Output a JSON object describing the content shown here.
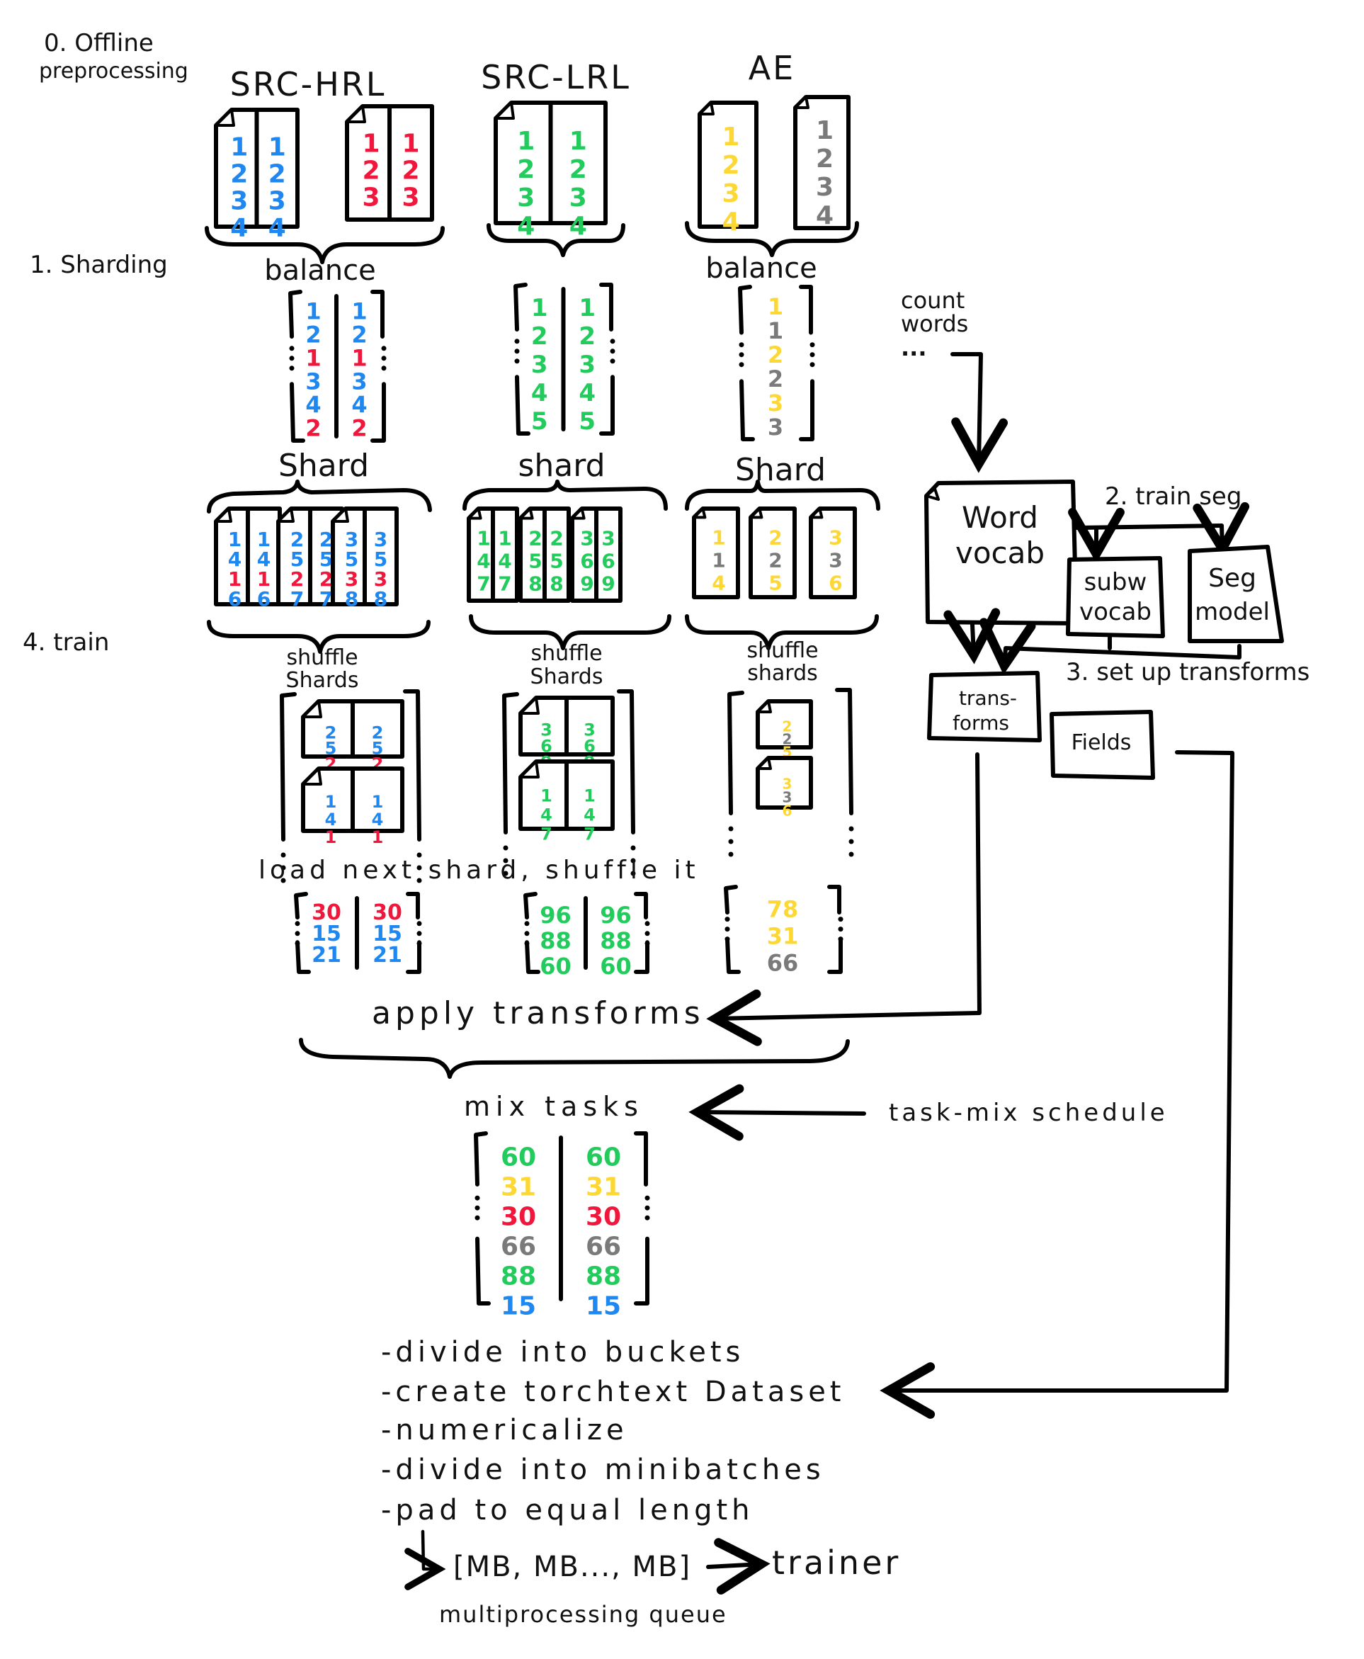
{
  "colors": {
    "hrl": "#1e88f0",
    "hrl_alt": "#f0163c",
    "lrl": "#22cc5c",
    "ae": "#fdd835",
    "ae_alt": "#7a7a7a",
    "ink": "#000000"
  },
  "steps": {
    "step0": "0. Offline preprocessing",
    "step0_line1": "0. Offline",
    "step0_line2": "preprocessing",
    "step1": "1. Sharding",
    "step2": "2. train seg",
    "step3": "3. set up transforms",
    "step4": "4. train"
  },
  "sources": [
    {
      "name": "SRC-HRL",
      "docs": [
        {
          "columns": [
            [
              [
                "1",
                "hrl"
              ],
              [
                "2",
                "hrl"
              ],
              [
                "3",
                "hrl"
              ],
              [
                "4",
                "hrl"
              ]
            ],
            [
              [
                "1",
                "hrl"
              ],
              [
                "2",
                "hrl"
              ],
              [
                "3",
                "hrl"
              ],
              [
                "4",
                "hrl"
              ]
            ]
          ]
        },
        {
          "columns": [
            [
              [
                "1",
                "hrl_alt"
              ],
              [
                "2",
                "hrl_alt"
              ],
              [
                "3",
                "hrl_alt"
              ]
            ],
            [
              [
                "1",
                "hrl_alt"
              ],
              [
                "2",
                "hrl_alt"
              ],
              [
                "3",
                "hrl_alt"
              ]
            ]
          ]
        }
      ],
      "balance_label": "balance",
      "balanced": [
        [
          [
            "1",
            "hrl"
          ],
          [
            "2",
            "hrl"
          ],
          [
            "1",
            "hrl_alt"
          ],
          [
            "3",
            "hrl"
          ],
          [
            "4",
            "hrl"
          ],
          [
            "2",
            "hrl_alt"
          ]
        ],
        [
          [
            "1",
            "hrl"
          ],
          [
            "2",
            "hrl"
          ],
          [
            "1",
            "hrl_alt"
          ],
          [
            "3",
            "hrl"
          ],
          [
            "4",
            "hrl"
          ],
          [
            "2",
            "hrl_alt"
          ]
        ]
      ],
      "shard_label": "Shard",
      "shards": [
        [
          [
            [
              "1",
              "hrl"
            ],
            [
              "4",
              "hrl"
            ],
            [
              "1",
              "hrl_alt"
            ],
            [
              "6",
              "hrl"
            ]
          ],
          [
            [
              "1",
              "hrl"
            ],
            [
              "4",
              "hrl"
            ],
            [
              "1",
              "hrl_alt"
            ],
            [
              "6",
              "hrl"
            ]
          ]
        ],
        [
          [
            [
              "2",
              "hrl"
            ],
            [
              "5",
              "hrl"
            ],
            [
              "2",
              "hrl_alt"
            ],
            [
              "7",
              "hrl"
            ]
          ],
          [
            [
              "2",
              "hrl"
            ],
            [
              "5",
              "hrl"
            ],
            [
              "2",
              "hrl_alt"
            ],
            [
              "7",
              "hrl"
            ]
          ]
        ],
        [
          [
            [
              "3",
              "hrl"
            ],
            [
              "5",
              "hrl"
            ],
            [
              "3",
              "hrl_alt"
            ],
            [
              "8",
              "hrl"
            ]
          ],
          [
            [
              "3",
              "hrl"
            ],
            [
              "5",
              "hrl"
            ],
            [
              "3",
              "hrl_alt"
            ],
            [
              "8",
              "hrl"
            ]
          ]
        ]
      ],
      "shuffle_label_1": "shuffle",
      "shuffle_label_2": "Shards",
      "shuffled": [
        [
          [
            [
              "2",
              "hrl"
            ],
            [
              "5",
              "hrl"
            ],
            [
              "2",
              "hrl_alt"
            ]
          ],
          [
            [
              "2",
              "hrl"
            ],
            [
              "5",
              "hrl"
            ],
            [
              "2",
              "hrl_alt"
            ]
          ]
        ],
        [
          [
            [
              "1",
              "hrl"
            ],
            [
              "4",
              "hrl"
            ],
            [
              "1",
              "hrl_alt"
            ]
          ],
          [
            [
              "1",
              "hrl"
            ],
            [
              "4",
              "hrl"
            ],
            [
              "1",
              "hrl_alt"
            ]
          ]
        ]
      ],
      "loaded": [
        [
          [
            "30",
            "hrl_alt"
          ],
          [
            "15",
            "hrl"
          ],
          [
            "21",
            "hrl"
          ]
        ],
        [
          [
            "30",
            "hrl_alt"
          ],
          [
            "15",
            "hrl"
          ],
          [
            "21",
            "hrl"
          ]
        ]
      ]
    },
    {
      "name": "SRC-LRL",
      "docs": [
        {
          "columns": [
            [
              [
                "1",
                "lrl"
              ],
              [
                "2",
                "lrl"
              ],
              [
                "3",
                "lrl"
              ],
              [
                "4",
                "lrl"
              ]
            ],
            [
              [
                "1",
                "lrl"
              ],
              [
                "2",
                "lrl"
              ],
              [
                "3",
                "lrl"
              ],
              [
                "4",
                "lrl"
              ]
            ]
          ]
        }
      ],
      "balance_label": "",
      "balanced": [
        [
          [
            "1",
            "lrl"
          ],
          [
            "2",
            "lrl"
          ],
          [
            "3",
            "lrl"
          ],
          [
            "4",
            "lrl"
          ],
          [
            "5",
            "lrl"
          ]
        ],
        [
          [
            "1",
            "lrl"
          ],
          [
            "2",
            "lrl"
          ],
          [
            "3",
            "lrl"
          ],
          [
            "4",
            "lrl"
          ],
          [
            "5",
            "lrl"
          ]
        ]
      ],
      "shard_label": "shard",
      "shards": [
        [
          [
            [
              "1",
              "lrl"
            ],
            [
              "4",
              "lrl"
            ],
            [
              "7",
              "lrl"
            ]
          ],
          [
            [
              "1",
              "lrl"
            ],
            [
              "4",
              "lrl"
            ],
            [
              "7",
              "lrl"
            ]
          ]
        ],
        [
          [
            [
              "2",
              "lrl"
            ],
            [
              "5",
              "lrl"
            ],
            [
              "8",
              "lrl"
            ]
          ],
          [
            [
              "2",
              "lrl"
            ],
            [
              "5",
              "lrl"
            ],
            [
              "8",
              "lrl"
            ]
          ]
        ],
        [
          [
            [
              "3",
              "lrl"
            ],
            [
              "6",
              "lrl"
            ],
            [
              "9",
              "lrl"
            ]
          ],
          [
            [
              "3",
              "lrl"
            ],
            [
              "6",
              "lrl"
            ],
            [
              "9",
              "lrl"
            ]
          ]
        ]
      ],
      "shuffle_label_1": "shuffle",
      "shuffle_label_2": "Shards",
      "shuffled": [
        [
          [
            [
              "3",
              "lrl"
            ],
            [
              "6",
              "lrl"
            ],
            [
              "9",
              "lrl"
            ]
          ],
          [
            [
              "3",
              "lrl"
            ],
            [
              "6",
              "lrl"
            ],
            [
              "9",
              "lrl"
            ]
          ]
        ],
        [
          [
            [
              "1",
              "lrl"
            ],
            [
              "4",
              "lrl"
            ],
            [
              "7",
              "lrl"
            ]
          ],
          [
            [
              "1",
              "lrl"
            ],
            [
              "4",
              "lrl"
            ],
            [
              "7",
              "lrl"
            ]
          ]
        ]
      ],
      "loaded": [
        [
          [
            "96",
            "lrl"
          ],
          [
            "88",
            "lrl"
          ],
          [
            "60",
            "lrl"
          ]
        ],
        [
          [
            "96",
            "lrl"
          ],
          [
            "88",
            "lrl"
          ],
          [
            "60",
            "lrl"
          ]
        ]
      ]
    },
    {
      "name": "AE",
      "docs": [
        {
          "columns": [
            [
              [
                "1",
                "ae"
              ],
              [
                "2",
                "ae"
              ],
              [
                "3",
                "ae"
              ],
              [
                "4",
                "ae"
              ]
            ]
          ]
        },
        {
          "columns": [
            [
              [
                "1",
                "ae_alt"
              ],
              [
                "2",
                "ae_alt"
              ],
              [
                "3",
                "ae_alt"
              ],
              [
                "4",
                "ae_alt"
              ]
            ]
          ]
        }
      ],
      "balance_label": "balance",
      "balanced": [
        [
          [
            "1",
            "ae"
          ],
          [
            "1",
            "ae_alt"
          ],
          [
            "2",
            "ae"
          ],
          [
            "2",
            "ae_alt"
          ],
          [
            "3",
            "ae"
          ],
          [
            "3",
            "ae_alt"
          ]
        ]
      ],
      "shard_label": "Shard",
      "shards": [
        [
          [
            [
              "1",
              "ae"
            ],
            [
              "1",
              "ae_alt"
            ],
            [
              "4",
              "ae"
            ]
          ]
        ],
        [
          [
            [
              "2",
              "ae"
            ],
            [
              "2",
              "ae_alt"
            ],
            [
              "5",
              "ae"
            ]
          ]
        ],
        [
          [
            [
              "3",
              "ae"
            ],
            [
              "3",
              "ae_alt"
            ],
            [
              "6",
              "ae"
            ]
          ]
        ]
      ],
      "shuffle_label_1": "shuffle",
      "shuffle_label_2": "shards",
      "shuffled": [
        [
          [
            [
              "2",
              "ae"
            ],
            [
              "2",
              "ae_alt"
            ],
            [
              "5",
              "ae"
            ]
          ]
        ],
        [
          [
            [
              "3",
              "ae"
            ],
            [
              "3",
              "ae_alt"
            ],
            [
              "6",
              "ae"
            ]
          ]
        ]
      ],
      "loaded": [
        [
          [
            "78",
            "ae"
          ],
          [
            "31",
            "ae"
          ],
          [
            "66",
            "ae_alt"
          ]
        ]
      ]
    }
  ],
  "vocab": {
    "count_words_1": "count",
    "count_words_2": "words",
    "count_words_3": "...",
    "word_vocab_1": "Word",
    "word_vocab_2": "vocab",
    "subw_vocab_1": "subw",
    "subw_vocab_2": "vocab",
    "seg_model_1": "Seg",
    "seg_model_2": "model",
    "transforms_1": "trans-",
    "transforms_2": "forms",
    "fields": "Fields"
  },
  "train": {
    "load_next_shard": "load next shard, shuffle it",
    "apply_transforms": "apply transforms",
    "mix_tasks": "mix tasks",
    "task_mix_schedule": "task-mix schedule",
    "mixed": [
      [
        [
          "60",
          "lrl"
        ],
        [
          "31",
          "ae"
        ],
        [
          "30",
          "hrl_alt"
        ],
        [
          "66",
          "ae_alt"
        ],
        [
          "88",
          "lrl"
        ],
        [
          "15",
          "hrl"
        ]
      ],
      [
        [
          "60",
          "lrl"
        ],
        [
          "31",
          "ae"
        ],
        [
          "30",
          "hrl_alt"
        ],
        [
          "66",
          "ae_alt"
        ],
        [
          "88",
          "lrl"
        ],
        [
          "15",
          "hrl"
        ]
      ]
    ],
    "bullets": [
      "-divide into buckets",
      "-create torchtext Dataset",
      "-numericalize",
      "-divide into minibatches",
      "-pad to equal length"
    ],
    "queue": "[MB, MB..., MB]",
    "queue_label": "multiprocessing queue",
    "trainer": "trainer"
  }
}
